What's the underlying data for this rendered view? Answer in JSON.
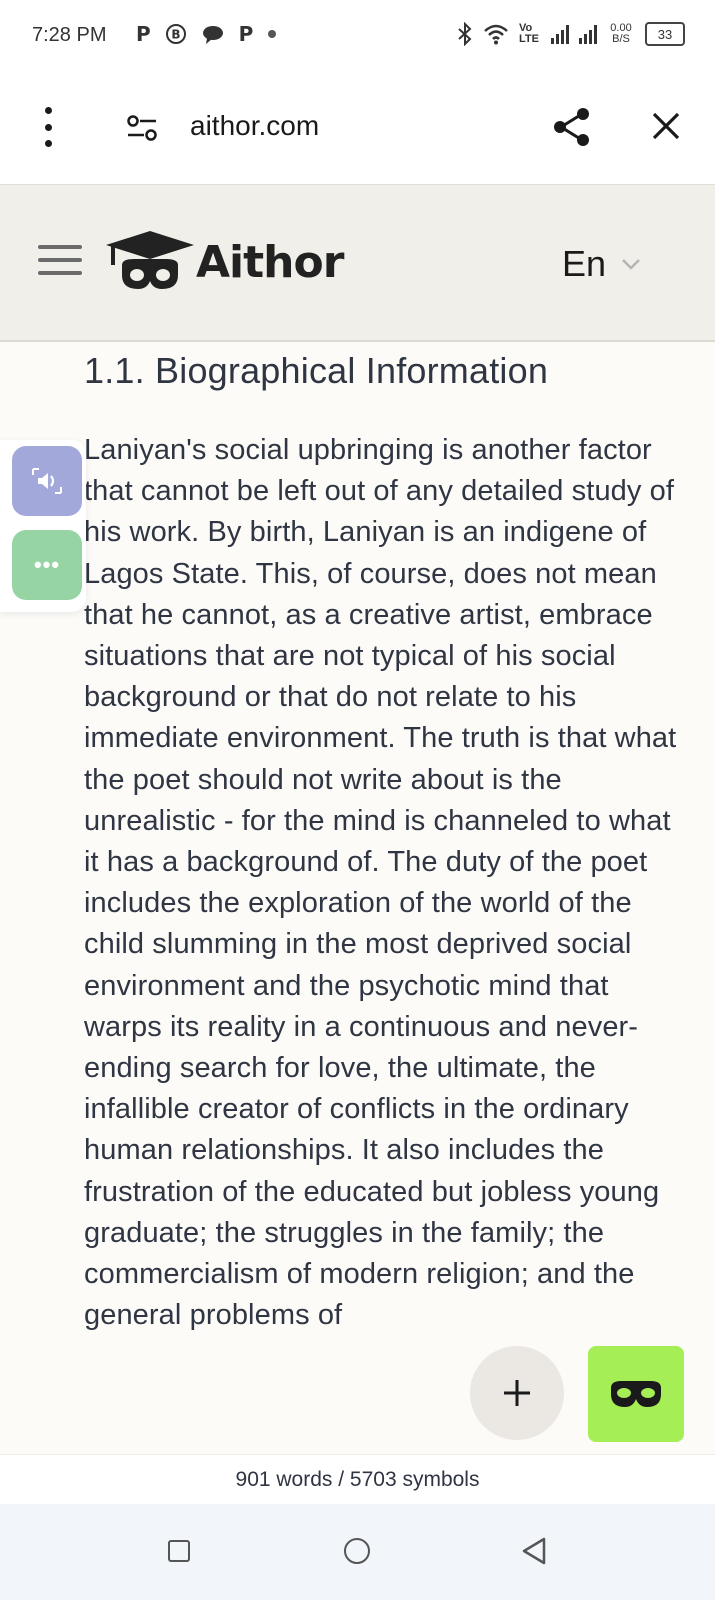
{
  "status_bar": {
    "time": "7:28 PM",
    "left_icons": [
      "P",
      "B",
      "chat",
      "P",
      "•"
    ],
    "volte": "Vo LTE",
    "net_speed": "0.00 B/S",
    "battery": "33"
  },
  "browser": {
    "url": "aithor.com"
  },
  "site_header": {
    "logo_text": "Aithor",
    "language": "En"
  },
  "article": {
    "heading": "1.1. Biographical Information",
    "body": "Laniyan's social upbringing is another factor that cannot be left out of any detailed study of his work. By birth, Laniyan is an indigene of Lagos State. This, of course, does not mean that he cannot, as a creative artist, embrace situations that are not typical of his social background or that do not relate to his immediate environment. The truth is that what the poet should not write about is the unrealistic - for the mind is channeled to what it has a background of. The duty of the poet includes the exploration of the world of the child slumming in the most deprived social environment and the psychotic mind that warps its reality in a continuous and never-ending search for love, the ultimate, the infallible creator of conflicts in the ordinary human relationships. It also includes the frustration of the educated but jobless young graduate; the struggles in the family; the commercialism of modern religion; and the general problems of"
  },
  "side_tools": {
    "more_label": "•••"
  },
  "fab": {
    "plus_label": "+"
  },
  "footer": {
    "count": "901 words / 5703 symbols"
  },
  "colors": {
    "header_bg": "#f1efe9",
    "content_bg": "#fcfbf8",
    "speak_btn": "#a3a8db",
    "more_btn": "#96d4a3",
    "mask_btn": "#a6ee55",
    "plus_btn": "#ebe7e2",
    "text": "#2f3542"
  }
}
